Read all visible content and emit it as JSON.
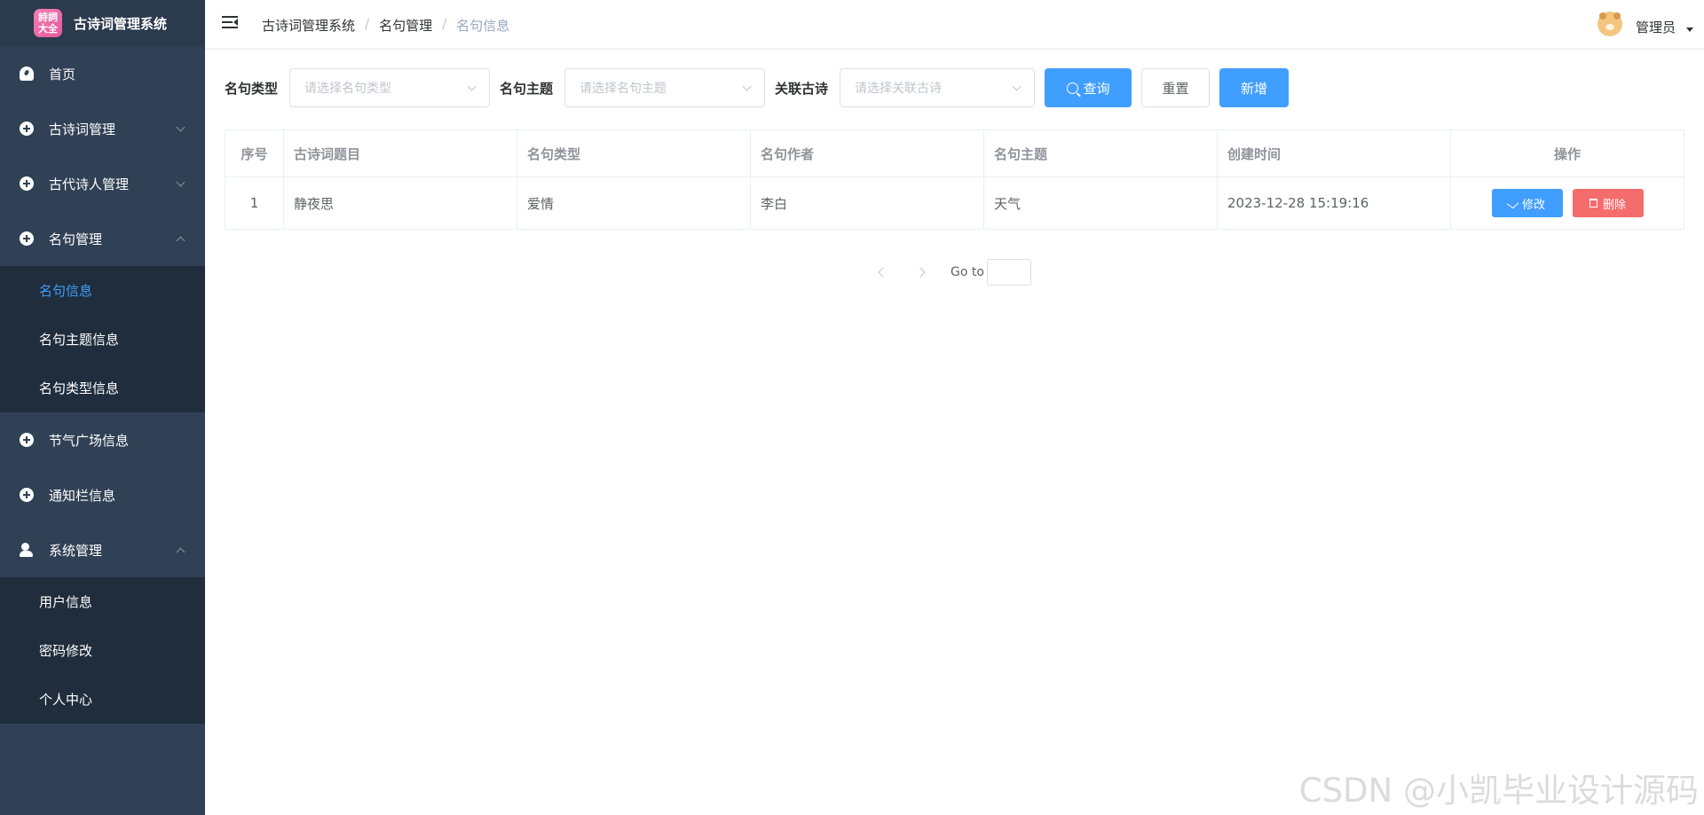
{
  "brand": {
    "logo_text": "詩詞大全",
    "title": "古诗词管理系统"
  },
  "sidebar": {
    "items": [
      {
        "label": "首页"
      },
      {
        "label": "古诗词管理"
      },
      {
        "label": "古代诗人管理"
      },
      {
        "label": "名句管理",
        "children": [
          "名句信息",
          "名句主题信息",
          "名句类型信息"
        ]
      },
      {
        "label": "节气广场信息"
      },
      {
        "label": "通知栏信息"
      },
      {
        "label": "系统管理",
        "children": [
          "用户信息",
          "密码修改",
          "个人中心"
        ]
      }
    ]
  },
  "header": {
    "breadcrumb": [
      "古诗词管理系统",
      "名句管理",
      "名句信息"
    ],
    "user_name": "管理员"
  },
  "search": {
    "type_label": "名句类型",
    "type_placeholder": "请选择名句类型",
    "theme_label": "名句主题",
    "theme_placeholder": "请选择名句主题",
    "poem_label": "关联古诗",
    "poem_placeholder": "请选择关联古诗",
    "query_label": "查询",
    "reset_label": "重置",
    "add_label": "新增"
  },
  "table": {
    "headers": [
      "序号",
      "古诗词题目",
      "名句类型",
      "名句作者",
      "名句主题",
      "创建时间",
      "操作"
    ],
    "rows": [
      {
        "index": "1",
        "title": "静夜思",
        "type": "爱情",
        "author": "李白",
        "theme": "天气",
        "created": "2023-12-28 15:19:16",
        "edit": "修改",
        "delete": "删除"
      }
    ]
  },
  "pagination": {
    "goto_label": "Go to"
  },
  "watermark": "CSDN @小凯毕业设计源码",
  "colors": {
    "sidebar_bg": "#304156",
    "submenu_bg": "#1f2d3d",
    "primary": "#409eff",
    "danger": "#f56c6c"
  }
}
